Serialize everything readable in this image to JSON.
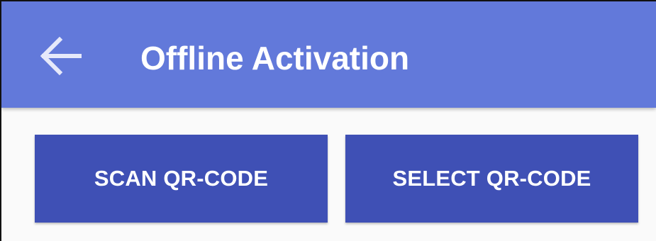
{
  "app_bar": {
    "title": "Offline Activation",
    "back_icon": "arrow-left-icon",
    "color": "#6279da"
  },
  "actions": {
    "scan_label": "SCAN QR-CODE",
    "select_label": "SELECT QR-CODE",
    "color": "#3f50b5"
  }
}
